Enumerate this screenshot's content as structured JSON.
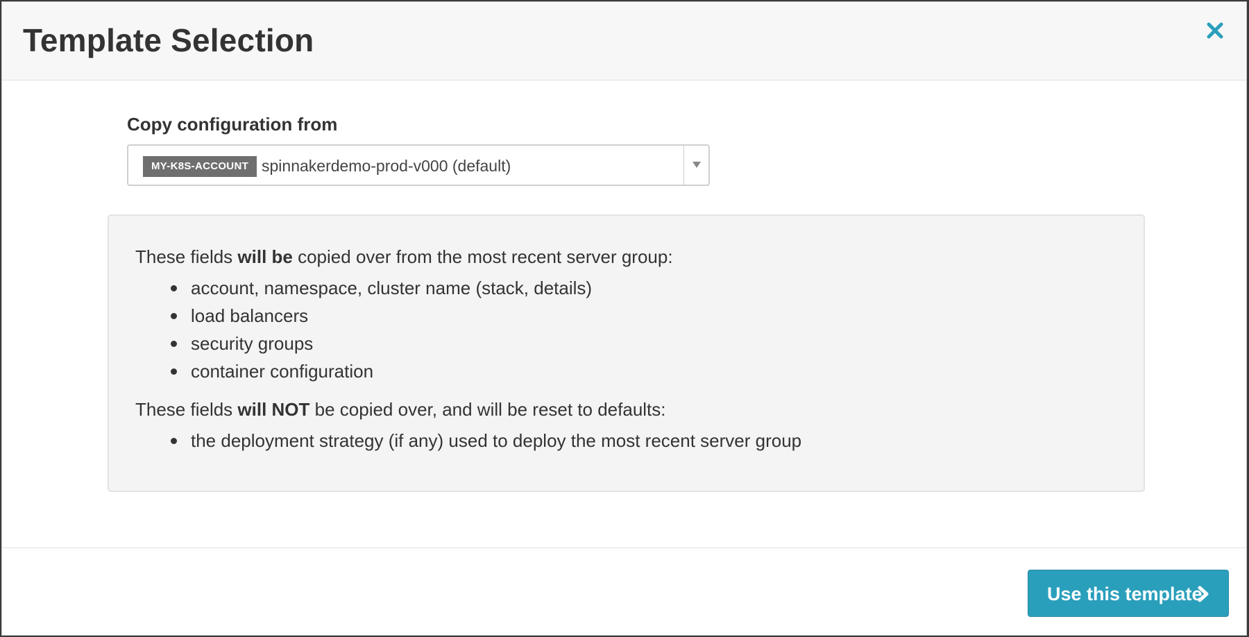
{
  "modal": {
    "title": "Template Selection",
    "close_icon": "close-icon"
  },
  "copy_config": {
    "label": "Copy configuration from",
    "account_tag": "MY-K8S-ACCOUNT",
    "selected_value": "spinnakerdemo-prod-v000 (default)",
    "dropdown_icon": "caret-down-icon"
  },
  "info": {
    "copied_prefix": "These fields ",
    "copied_emphasis": "will be",
    "copied_suffix": " copied over from the most recent server group:",
    "copied_items": [
      "account, namespace, cluster name (stack, details)",
      "load balancers",
      "security groups",
      "container configuration"
    ],
    "not_copied_prefix": "These fields ",
    "not_copied_emphasis": "will NOT",
    "not_copied_suffix": " be copied over, and will be reset to defaults:",
    "not_copied_items": [
      "the deployment strategy (if any) used to deploy the most recent server group"
    ]
  },
  "footer": {
    "primary_button_label": "Use this template",
    "primary_button_icon": "chevron-right-icon"
  },
  "colors": {
    "primary": "#2a9fbc",
    "close_icon": "#2a9fbc",
    "account_tag_bg": "#6f6f6f"
  }
}
